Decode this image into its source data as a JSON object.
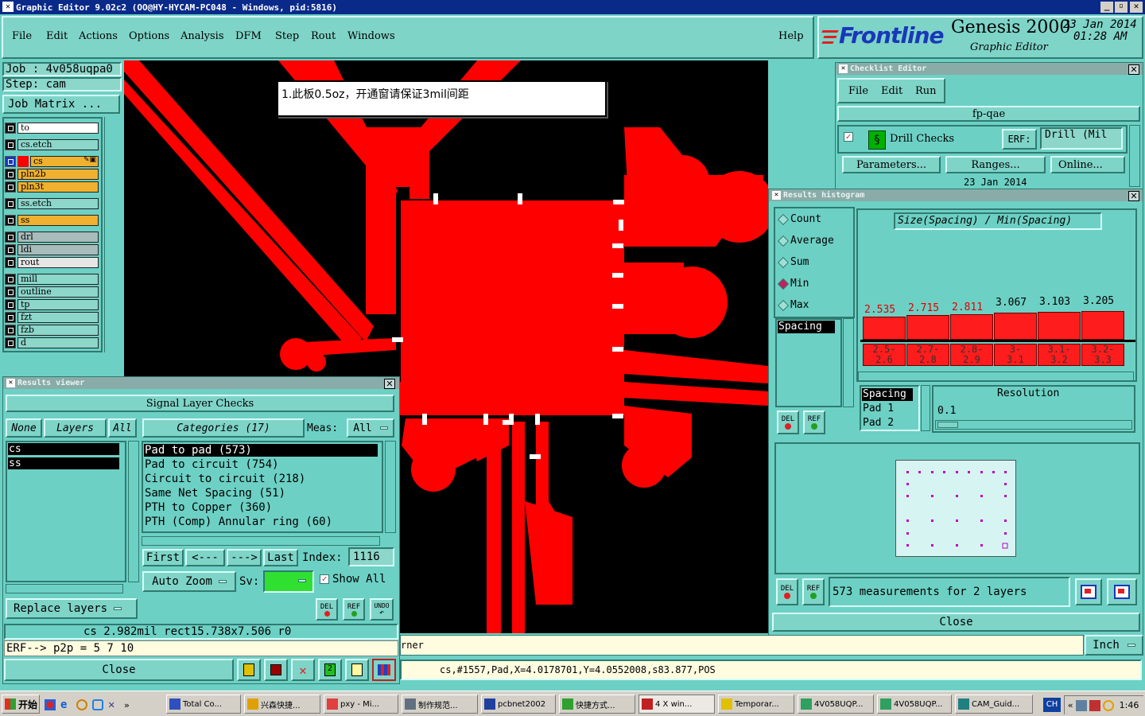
{
  "window": {
    "title": "Graphic Editor 9.02c2  (OO@HY-HYCAM-PC048 - Windows, pid:5816)"
  },
  "menu": [
    "File",
    "Edit",
    "Actions",
    "Options",
    "Analysis",
    "DFM",
    "Step",
    "Rout",
    "Windows"
  ],
  "help_label": "Help",
  "brand": {
    "logo": "Frontline",
    "product": "Genesis 2000",
    "subtitle": "Graphic Editor",
    "date": "23 Jan 2014",
    "time": "01:28 AM"
  },
  "job": {
    "job_label": "Job : 4v058uqpa0",
    "step_label": "Step: cam",
    "matrix_button": "Job Matrix ..."
  },
  "layers": [
    {
      "name": "to",
      "color": "#ffffff",
      "icon": ""
    },
    {
      "name": "cs.etch",
      "color": "#8cd6ca",
      "icon": ""
    },
    {
      "name": "cs",
      "color": "#f0b030",
      "icon": "✎▣",
      "active": true
    },
    {
      "name": "pln2b",
      "color": "#f0b030",
      "icon": ""
    },
    {
      "name": "pln3t",
      "color": "#f0b030",
      "icon": ""
    },
    {
      "name": "ss.etch",
      "color": "#8cd6ca",
      "icon": ""
    },
    {
      "name": "ss",
      "color": "#f0b030",
      "icon": ""
    },
    {
      "name": "drl",
      "color": "#a8bcbc",
      "icon": ""
    },
    {
      "name": "ldi",
      "color": "#a8bcbc",
      "icon": ""
    },
    {
      "name": "rout",
      "color": "#e6e6e6",
      "icon": ""
    },
    {
      "name": "mill",
      "color": "#8cd6ca",
      "icon": ""
    },
    {
      "name": "outline",
      "color": "#8cd6ca",
      "icon": ""
    },
    {
      "name": "tp",
      "color": "#8cd6ca",
      "icon": ""
    },
    {
      "name": "fzt",
      "color": "#8cd6ca",
      "icon": ""
    },
    {
      "name": "fzb",
      "color": "#8cd6ca",
      "icon": ""
    },
    {
      "name": "d",
      "color": "#8cd6ca",
      "icon": ""
    }
  ],
  "note": "1.此板0.5oz，开通窗请保证3mil间距",
  "checklist": {
    "title": "Checklist Editor",
    "menu": [
      "File",
      "Edit",
      "Run"
    ],
    "name": "fp-qae",
    "action": "Drill Checks",
    "erf_label": "ERF:",
    "erf_value": "Drill (Mil",
    "buttons": [
      "Parameters...",
      "Ranges...",
      "Online..."
    ],
    "date": "23 Jan 2014"
  },
  "histogram": {
    "title": "Results histogram",
    "modes": [
      {
        "label": "Count",
        "selected": false
      },
      {
        "label": "Average",
        "selected": false
      },
      {
        "label": "Sum",
        "selected": false
      },
      {
        "label": "Min",
        "selected": true
      },
      {
        "label": "Max",
        "selected": false
      }
    ],
    "measure_list": [
      "Spacing"
    ],
    "formula": "Size(Spacing) / Min(Spacing)",
    "fields": [
      "Spacing",
      "Pad 1",
      "Pad 2"
    ],
    "resolution_label": "Resolution",
    "resolution_value": "0.1",
    "measurements": "573 measurements for 2 layers",
    "close": "Close",
    "del": "DEL",
    "ref": "REF"
  },
  "chart_data": {
    "type": "bar",
    "title": "Size(Spacing) / Min(Spacing)",
    "categories": [
      "2.5-2.6",
      "2.7-2.8",
      "2.8-2.9",
      "3-3.1",
      "3.1-3.2",
      "3.2-3.3"
    ],
    "category_labels": [
      [
        "2.5-",
        "2.6"
      ],
      [
        "2.7-",
        "2.8"
      ],
      [
        "2.8-",
        "2.9"
      ],
      [
        "3-",
        "3.1"
      ],
      [
        "3.1-",
        "3.2"
      ],
      [
        "3.2-",
        "3.3"
      ]
    ],
    "values": [
      2.535,
      2.715,
      2.811,
      3.067,
      3.103,
      3.205
    ],
    "value_labels": [
      "2.535",
      "2.715",
      "2.811",
      "3.067",
      "3.103",
      "3.205"
    ],
    "value_label_colors": [
      "#e00000",
      "#e00000",
      "#e00000",
      "#000000",
      "#000000",
      "#000000"
    ],
    "bar_color": "#ff1c1c"
  },
  "results": {
    "title": "Results viewer",
    "header": "Signal Layer Checks",
    "none": "None",
    "layers_tab": "Layers",
    "all": "All",
    "categories_tab": "Categories (17)",
    "meas_label": "Meas:",
    "meas_value": "All",
    "layer_list": [
      "cs",
      "ss"
    ],
    "categories": [
      "Pad to pad (573)",
      "Pad to circuit (754)",
      "Circuit to circuit (218)",
      "Same Net Spacing (51)",
      "PTH to Copper (360)",
      "PTH (Comp) Annular ring (60)"
    ],
    "nav": [
      "First",
      "<---",
      "--->",
      "Last"
    ],
    "index_label": "Index:",
    "index_value": "1116",
    "auto_zoom": "Auto Zoom",
    "sv_label": "Sv:",
    "show_all": "Show All",
    "replace_layers": "Replace layers",
    "del": "DEL",
    "ref": "REF",
    "undo": "UNDO",
    "readout": "cs 2.982mil   rect15.738x7.506   r0",
    "erf": "ERF--> p2p = 5 7 10",
    "close": "Close"
  },
  "status": {
    "corner_text": "rner",
    "coords": "cs,#1557,Pad,X=4.0178701,Y=4.0552008,s83.877,POS",
    "units": "Inch"
  },
  "taskbar": {
    "start": "开始",
    "items": [
      "Total Co...",
      "兴森快捷...",
      "pxy - Mi...",
      "制作规范...",
      "pcbnet2002",
      "快捷方式...",
      "4 X win...",
      "Temporar...",
      "4V058UQP...",
      "4V058UQP...",
      "CAM_Guid..."
    ],
    "lang": "CH",
    "clock": "1:46"
  }
}
